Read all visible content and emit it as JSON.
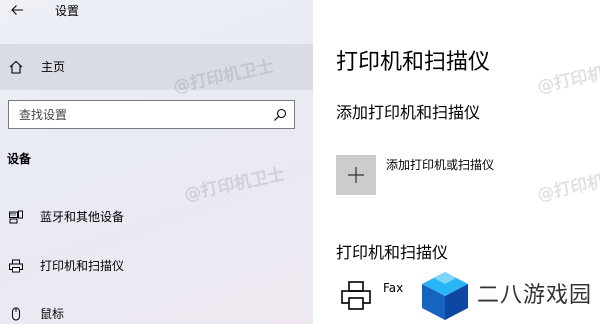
{
  "window": {
    "title": "设置"
  },
  "sidebar": {
    "home_label": "主页",
    "search_placeholder": "查找设置",
    "section_header": "设备",
    "items": [
      {
        "label": "蓝牙和其他设备",
        "icon": "bluetooth-devices-icon"
      },
      {
        "label": "打印机和扫描仪",
        "icon": "printer-icon"
      },
      {
        "label": "鼠标",
        "icon": "mouse-icon"
      }
    ]
  },
  "watermark_text": "@打印机卫士",
  "content": {
    "page_title": "打印机和扫描仪",
    "add_section_title": "添加打印机和扫描仪",
    "add_button_label": "添加打印机或扫描仪",
    "list_section_title": "打印机和扫描仪",
    "printers": [
      {
        "name": "Fax"
      }
    ]
  },
  "site_logo": {
    "text": "二八游戏园"
  },
  "colors": {
    "sidebar_bg": "#eef0f6",
    "selected_item_bg": "#d9dce2",
    "add_tile_bg": "#cccccc",
    "logo_blue": "#1e88e5",
    "logo_dark_blue": "#0d47a1"
  }
}
